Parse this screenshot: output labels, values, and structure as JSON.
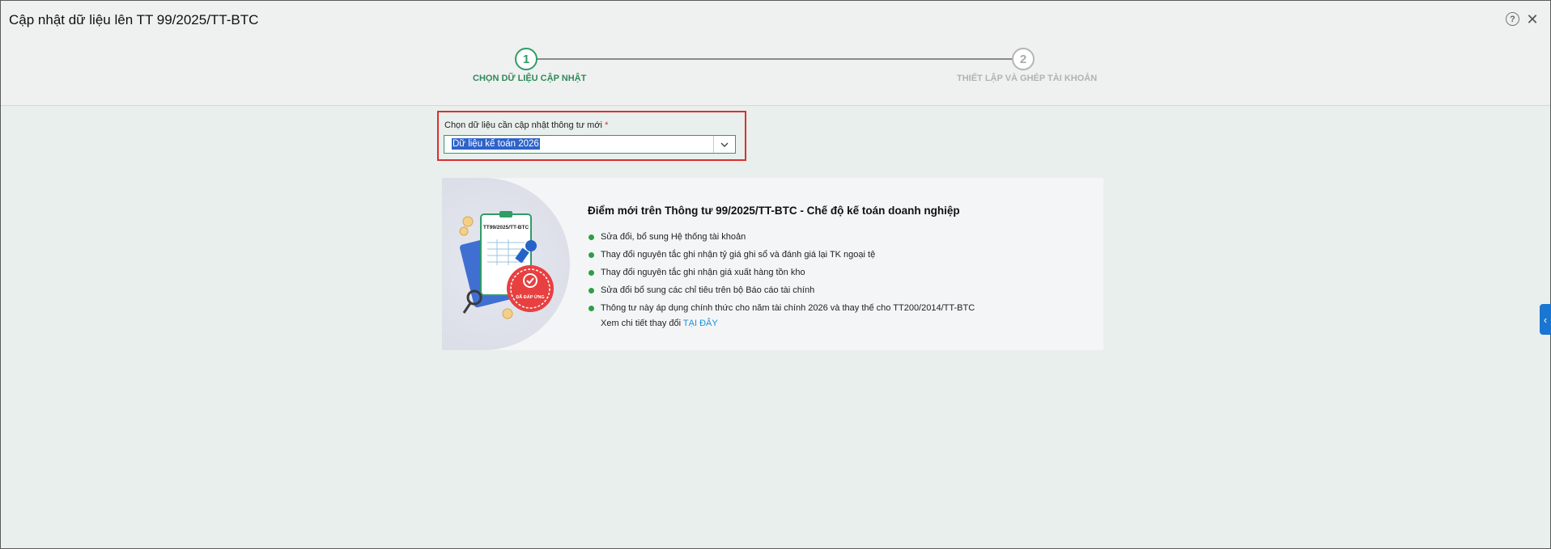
{
  "header": {
    "title": "Cập nhật dữ liệu lên TT 99/2025/TT-BTC",
    "help_icon": "?",
    "close_icon": "✕"
  },
  "steps": [
    {
      "number": "1",
      "label": "CHỌN DỮ LIỆU CẬP NHẬT",
      "state": "active"
    },
    {
      "number": "2",
      "label": "THIẾT LẬP VÀ GHÉP TÀI KHOẢN",
      "state": "inactive"
    }
  ],
  "form": {
    "label": "Chọn dữ liệu cần cập nhật thông tư mới",
    "required_mark": "*",
    "selected_value": "Dữ liệu kế toán 2026",
    "dropdown_icon": "chevron-down-icon"
  },
  "info": {
    "title": "Điểm mới trên Thông tư 99/2025/TT-BTC - Chế độ kế toán doanh nghiệp",
    "bullets": [
      "Sửa đổi, bổ sung Hệ thống tài khoản",
      "Thay đổi nguyên tắc ghi nhận tỷ giá ghi sổ và đánh giá lại TK ngoại tệ",
      "Thay đổi nguyên tắc ghi nhận giá xuất hàng tồn kho",
      "Sửa đổi bổ sung các chỉ tiêu trên bộ Báo cáo tài chính",
      "Thông tư này áp dụng chính thức cho năm tài chính 2026 và thay thế cho TT200/2014/TT-BTC"
    ],
    "more_text": "Xem chi tiết thay đổi",
    "more_link": "TẠI ĐÂY",
    "illustration": {
      "doc_heading": "TT99/2025/TT-BTC",
      "stamp_text": "ĐÃ ĐÁP ỨNG"
    }
  },
  "colors": {
    "accent": "#2f9d66",
    "highlight_border": "#d93030",
    "link": "#1f8fd6",
    "side_tab": "#1976d2"
  }
}
